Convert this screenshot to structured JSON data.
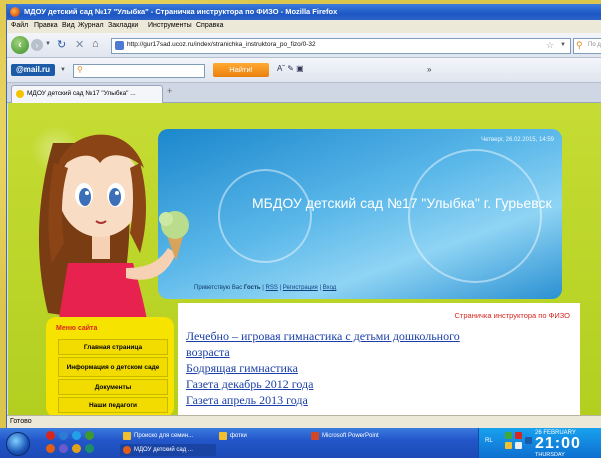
{
  "window": {
    "title": "МДОУ детский сад №17 \"Улыбка\" - Страничка инструктора по ФИЗО - Mozilla Firefox"
  },
  "menu": [
    "Файл",
    "Правка",
    "Вид",
    "Журнал",
    "Закладки",
    "Инструменты",
    "Справка"
  ],
  "nav": {
    "url": "http://gur17sad.ucoz.ru/index/stranichka_instruktora_po_fizo/0-32",
    "search_placeholder": "По д"
  },
  "mailbar": {
    "logo": "@mail.ru",
    "find_label": "Найти!",
    "more": "»"
  },
  "tabs": [
    {
      "label": "МДОУ детский сад №17 \"Улыбка\" ..."
    }
  ],
  "page": {
    "date": "Четверг, 26.02.2015, 14:59",
    "site_title": "МБДОУ детский сад №17 \"Улыбка\" г. Гурьевск",
    "greeting": "Приветствую Вас",
    "guest": "Гость",
    "rss": "RSS",
    "register": "Регистрация",
    "login": "Вход",
    "menu_header": "Меню сайта",
    "menu_items": [
      "Главная страница",
      "Информация о детском саде",
      "Документы",
      "Наши педагоги"
    ],
    "panel_title": "Страничка инструктора по ФИЗО",
    "links": [
      "Лечебно – игровая гимнастика с детьми дошкольного",
      "возраста",
      "Бодрящая гимнастика",
      "Газета декабрь 2012 года",
      "Газета апрель 2013 года"
    ]
  },
  "status": "Готово",
  "taskbar": {
    "buttons": [
      "Пpoиско для семин...",
      "фотки",
      "Microsoft PowerPoint",
      "МДОУ детский сад ..."
    ],
    "lang": "RL",
    "clock_date": "26 FEBRUARY",
    "clock_time": "21:00",
    "clock_weekday": "THURSDAY"
  },
  "colors": {
    "titlebar": "#1d57c4",
    "page_bg": "#b8d426",
    "link": "#1a3fa8",
    "accent_red": "#d8261f",
    "menu_yellow": "#f7e300"
  }
}
